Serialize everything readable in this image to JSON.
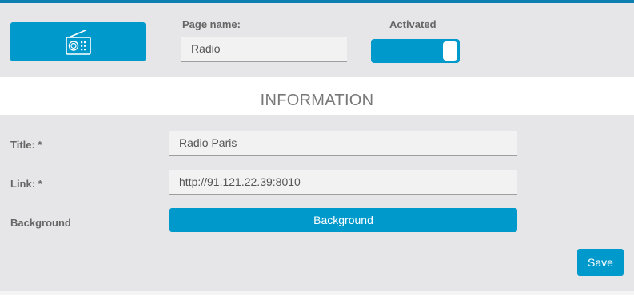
{
  "colors": {
    "accent": "#0099cc",
    "top_bar": "#0e7fb3",
    "panel_bg": "#e6e6e8",
    "input_bg": "#f2f2f2"
  },
  "header": {
    "icon": "radio-icon",
    "page_name_label": "Page name:",
    "page_name_value": "Radio",
    "activated_label": "Activated",
    "activated_on": true
  },
  "section": {
    "title": "INFORMATION"
  },
  "form": {
    "title_label": "Title: *",
    "title_value": "Radio Paris",
    "link_label": "Link: *",
    "link_value": "http://91.121.22.39:8010",
    "background_label": "Background",
    "background_button": "Background",
    "save_button": "Save"
  }
}
